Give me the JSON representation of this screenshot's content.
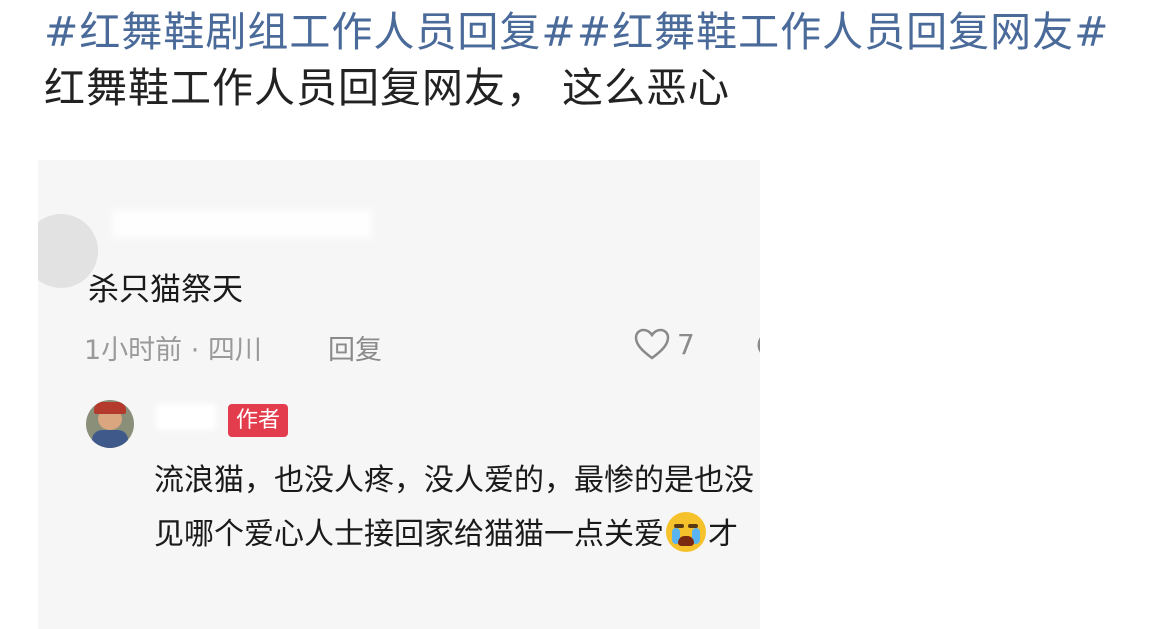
{
  "post": {
    "tag1": "#红舞鞋剧组工作人员回复#",
    "tag2": "#红舞鞋工作人员回复网友#",
    "text": " 红舞鞋工作人员回复网友， 这么恶心"
  },
  "screenshot": {
    "comment1": {
      "text": "杀只猫祭天",
      "meta": "1小时前 · 四川",
      "reply_label": "回复",
      "like_count": "7"
    },
    "comment2": {
      "badge": "作者",
      "text_before_emoji": "流浪猫，也没人疼，没人爱的，最惨的是也没见哪个爱心人士接回家给猫猫一点关爱",
      "text_after_emoji": "才"
    }
  },
  "icons": {
    "like": "heart-outline-icon",
    "emoji": "crying-face-emoji"
  },
  "colors": {
    "tag": "#4a6a99",
    "badge": "#e23c4d"
  }
}
